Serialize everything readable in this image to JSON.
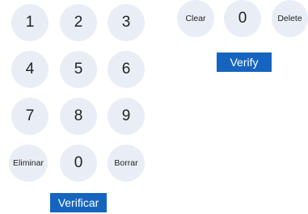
{
  "left_pad": {
    "keys": [
      "1",
      "2",
      "3",
      "4",
      "5",
      "6",
      "7",
      "8",
      "9",
      "Eliminar",
      "0",
      "Borrar"
    ],
    "submit_label": "Verificar"
  },
  "right_pad": {
    "keys": [
      "Clear",
      "0",
      "Delete"
    ],
    "submit_label": "Verify"
  },
  "colors": {
    "key_background": "#e9eef6",
    "key_text": "#222222",
    "button_background": "#1565c0",
    "button_text": "#ffffff"
  }
}
